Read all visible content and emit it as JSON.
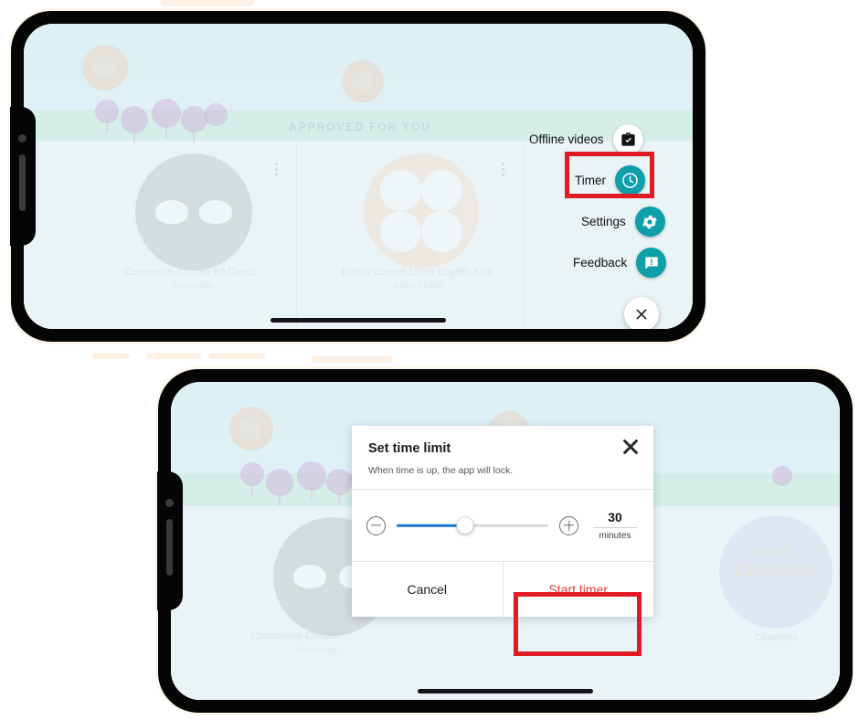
{
  "phone1": {
    "kicker": "APPROVED FOR YOU",
    "cards": [
      {
        "title": "Cocomelon Chhota Ko Dance",
        "subtitle": "Cocomelon"
      },
      {
        "title": "British Council Learn English Kids",
        "subtitle": "Learn English"
      }
    ],
    "menu": {
      "items": [
        {
          "label": "Offline videos",
          "icon": "briefcase-check-icon",
          "icon_style": "white",
          "highlighted": false
        },
        {
          "label": "Timer",
          "icon": "clock-icon",
          "icon_style": "teal",
          "highlighted": true
        },
        {
          "label": "Settings",
          "icon": "gear-icon",
          "icon_style": "teal",
          "highlighted": false
        },
        {
          "label": "Feedback",
          "icon": "feedback-chat-icon",
          "icon_style": "teal",
          "highlighted": false
        }
      ],
      "close_icon": "close-icon"
    }
  },
  "phone2": {
    "cards": [
      {
        "title": "Cocomelon Children",
        "subtitle": "Cocomelon"
      },
      {
        "title": "CBeebies",
        "subtitle": "CBeebies"
      }
    ],
    "cbeebies": {
      "line1": "BBC",
      "line2": "CBeebies"
    },
    "dialog": {
      "title": "Set time limit",
      "subtitle": "When time is up, the app will lock.",
      "close_icon": "close-icon",
      "decrement_icon": "minus-circle-icon",
      "increment_icon": "plus-circle-icon",
      "slider": {
        "value": 30,
        "unit": "minutes",
        "percent": 45
      },
      "buttons": {
        "cancel": "Cancel",
        "confirm": "Start timer"
      }
    }
  },
  "colors": {
    "highlight": "#e01b24",
    "accent_teal": "#0e9fa8",
    "slider_blue": "#1b78d4",
    "danger_text": "#e03b3b"
  }
}
